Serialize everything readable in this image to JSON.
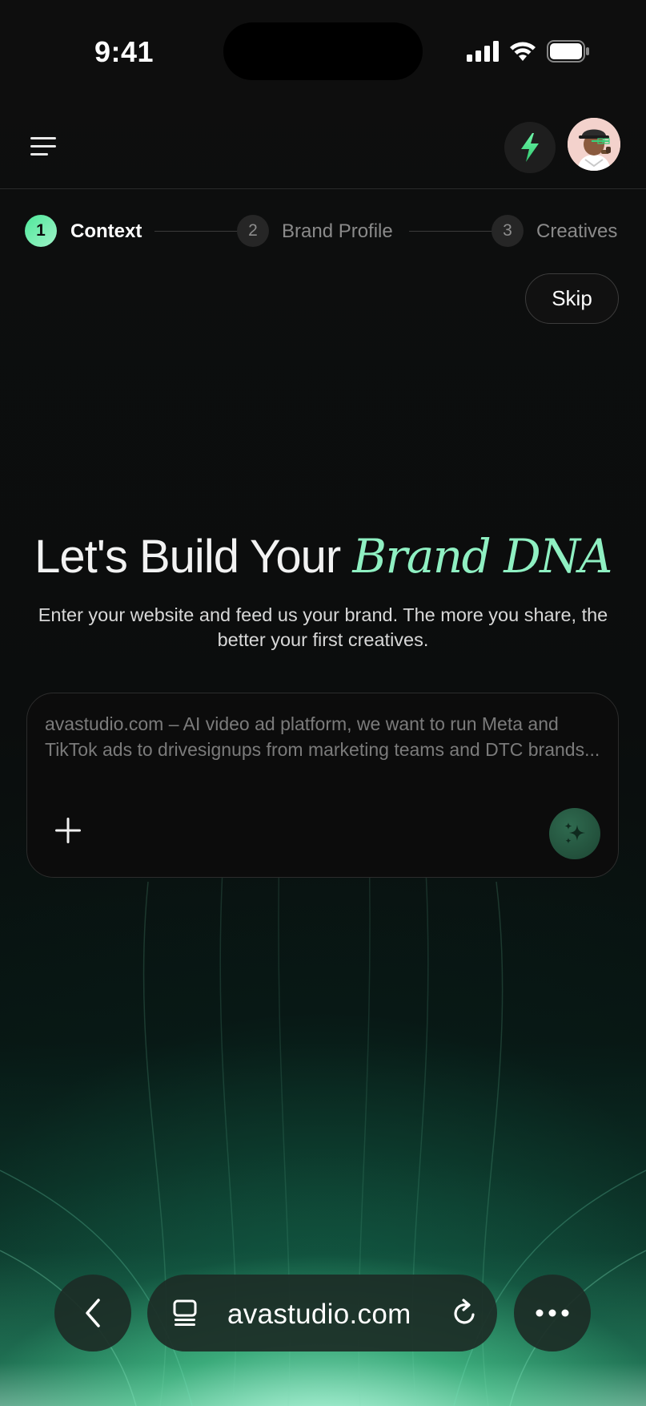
{
  "status_bar": {
    "time": "9:41",
    "icons": [
      "cellular-signal-icon",
      "wifi-icon",
      "battery-icon"
    ]
  },
  "header": {
    "menu_icon": "hamburger-menu-icon",
    "bolt_icon": "lightning-bolt-icon",
    "avatar": "user-avatar",
    "accent_color": "#4ee89a"
  },
  "stepper": {
    "steps": [
      {
        "number": "1",
        "label": "Context",
        "active": true
      },
      {
        "number": "2",
        "label": "Brand Profile",
        "active": false
      },
      {
        "number": "3",
        "label": "Creatives",
        "active": false
      }
    ]
  },
  "skip_label": "Skip",
  "hero": {
    "title_plain": "Let's Build Your",
    "title_accent": "Brand DNA",
    "subtitle": "Enter your website and feed us your brand. The more you share, the better your first creatives."
  },
  "prompt": {
    "placeholder": "avastudio.com – AI video ad platform, we want to run Meta and TikTok ads to drivesignups from marketing teams and DTC brands...",
    "value": "",
    "attach_icon": "plus-icon",
    "generate_icon": "sparkles-icon"
  },
  "browser": {
    "url": "avastudio.com",
    "back_icon": "chevron-left-icon",
    "tabs_icon": "tabs-icon",
    "reload_icon": "reload-icon",
    "more_icon": "more-dots-icon"
  },
  "colors": {
    "background": "#0d0d0d",
    "accent_green": "#8ff0c2",
    "active_step": "#4ee89a"
  }
}
